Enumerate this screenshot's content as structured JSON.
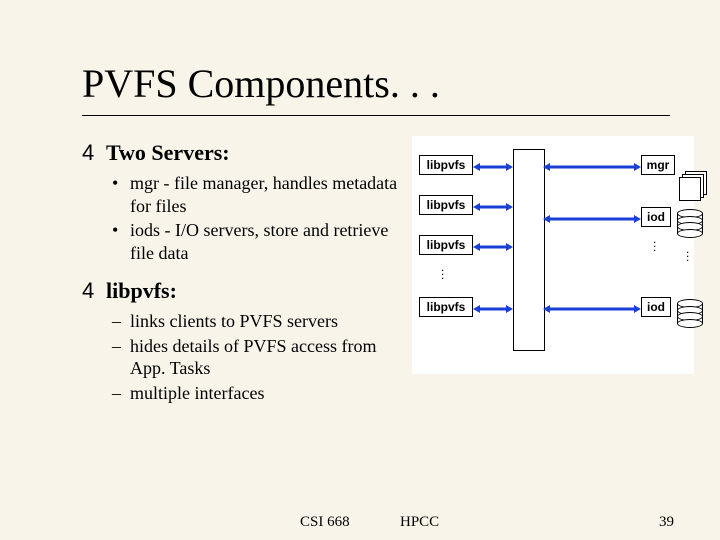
{
  "slide": {
    "title": "PVFS Components. . .",
    "sections": [
      {
        "heading": "Two Servers:",
        "bullet_glyph": "4",
        "style": "disc",
        "items": [
          "mgr - file manager, handles metadata for files",
          "iods - I/O servers, store and retrieve file data"
        ]
      },
      {
        "heading": "libpvfs:",
        "bullet_glyph": "4",
        "style": "dash",
        "items": [
          "links clients to PVFS servers",
          "hides details of PVFS access from App. Tasks",
          "multiple interfaces"
        ]
      }
    ],
    "diagram": {
      "libpvfs_label": "libpvfs",
      "mgr_label": "mgr",
      "iod_label": "iod",
      "vdots": ". . ."
    },
    "footer": {
      "course": "CSI 668",
      "org": "HPCC",
      "pagenum": "39"
    }
  }
}
